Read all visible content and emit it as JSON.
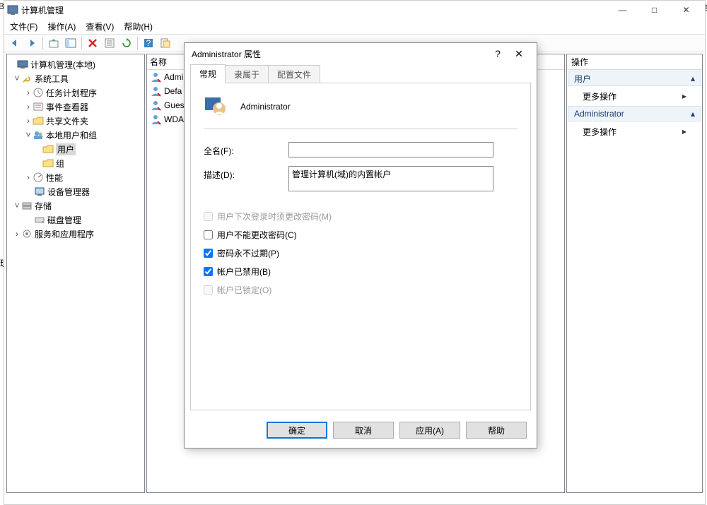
{
  "window": {
    "title": "计算机管理",
    "minimize": "—",
    "maximize": "□",
    "close": "✕"
  },
  "menubar": {
    "file": "文件(F)",
    "action": "操作(A)",
    "view": "查看(V)",
    "help": "帮助(H)"
  },
  "tree": {
    "root": "计算机管理(本地)",
    "system_tools": "系统工具",
    "task_scheduler": "任务计划程序",
    "event_viewer": "事件查看器",
    "shared_folders": "共享文件夹",
    "local_users_groups": "本地用户和组",
    "users": "用户",
    "groups": "组",
    "performance": "性能",
    "device_manager": "设备管理器",
    "storage": "存储",
    "disk_mgmt": "磁盘管理",
    "services_apps": "服务和应用程序"
  },
  "mid": {
    "header_name": "名称",
    "rows": [
      "Admi",
      "Defa",
      "Gues",
      "WDA"
    ]
  },
  "actions": {
    "header": "操作",
    "section1": "用户",
    "more1": "更多操作",
    "section2": "Administrator",
    "more2": "更多操作"
  },
  "dialog": {
    "title": "Administrator 属性",
    "help": "?",
    "close": "✕",
    "tabs": {
      "general": "常规",
      "member_of": "隶属于",
      "profile": "配置文件"
    },
    "username": "Administrator",
    "fullname_label": "全名(F):",
    "fullname_value": "",
    "desc_label": "描述(D):",
    "desc_value": "管理计算机(域)的内置帐户",
    "chk_change_next": "用户下次登录时须更改密码(M)",
    "chk_cannot_change": "用户不能更改密码(C)",
    "chk_never_expire": "密码永不过期(P)",
    "chk_disabled": "帐户已禁用(B)",
    "chk_locked": "帐户已锁定(O)",
    "btn_ok": "确定",
    "btn_cancel": "取消",
    "btn_apply": "应用(A)",
    "btn_help": "帮助"
  },
  "edge": {
    "left_top": "B",
    "right_top": "维",
    "left_mid": "理"
  }
}
